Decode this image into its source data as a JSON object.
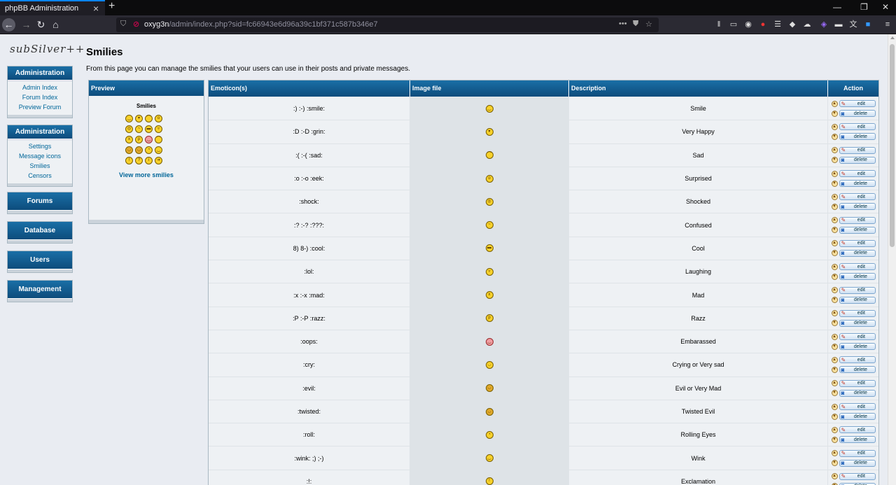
{
  "browser": {
    "tab_title": "phpBB Administration",
    "url_host": "oxyg3n",
    "url_path": "/admin/index.php?sid=fc66943e6d96a39c1bf371c587b346e7"
  },
  "logo_text": "subSilver++",
  "sidebar": [
    {
      "title": "Administration",
      "links": [
        "Admin Index",
        "Forum Index",
        "Preview Forum"
      ]
    },
    {
      "title": "Administration",
      "links": [
        "Settings",
        "Message icons",
        "Smilies",
        "Censors"
      ]
    },
    {
      "title": "Forums",
      "links": []
    },
    {
      "title": "Database",
      "links": []
    },
    {
      "title": "Users",
      "links": []
    },
    {
      "title": "Management",
      "links": []
    }
  ],
  "page": {
    "title": "Smilies",
    "intro": "From this page you can manage the smilies that your users can use in their posts and private messages."
  },
  "preview": {
    "header": "Preview",
    "subtitle": "Smilies",
    "view_more": "View more smilies"
  },
  "table": {
    "headers": [
      "Emoticon(s)",
      "Image file",
      "Description",
      "Action"
    ],
    "edit_label": "edit",
    "delete_label": "delete",
    "rows": [
      {
        "codes": ":) :-) :smile:",
        "description": "Smile"
      },
      {
        "codes": ":D :-D :grin:",
        "description": "Very Happy"
      },
      {
        "codes": ":( :-( :sad:",
        "description": "Sad"
      },
      {
        "codes": ":o :-o :eek:",
        "description": "Surprised"
      },
      {
        "codes": ":shock:",
        "description": "Shocked"
      },
      {
        "codes": ":? :-? :???:",
        "description": "Confused"
      },
      {
        "codes": "8) 8-) :cool:",
        "description": "Cool"
      },
      {
        "codes": ":lol:",
        "description": "Laughing"
      },
      {
        "codes": ":x :-x :mad:",
        "description": "Mad"
      },
      {
        "codes": ":P :-P :razz:",
        "description": "Razz"
      },
      {
        "codes": ":oops:",
        "description": "Embarassed"
      },
      {
        "codes": ":cry:",
        "description": "Crying or Very sad"
      },
      {
        "codes": ":evil:",
        "description": "Evil or Very Mad"
      },
      {
        "codes": ":twisted:",
        "description": "Twisted Evil"
      },
      {
        "codes": ":roll:",
        "description": "Rolling Eyes"
      },
      {
        "codes": ":wink: ;) ;-)",
        "description": "Wink"
      },
      {
        "codes": ":!:",
        "description": "Exclamation"
      }
    ]
  }
}
